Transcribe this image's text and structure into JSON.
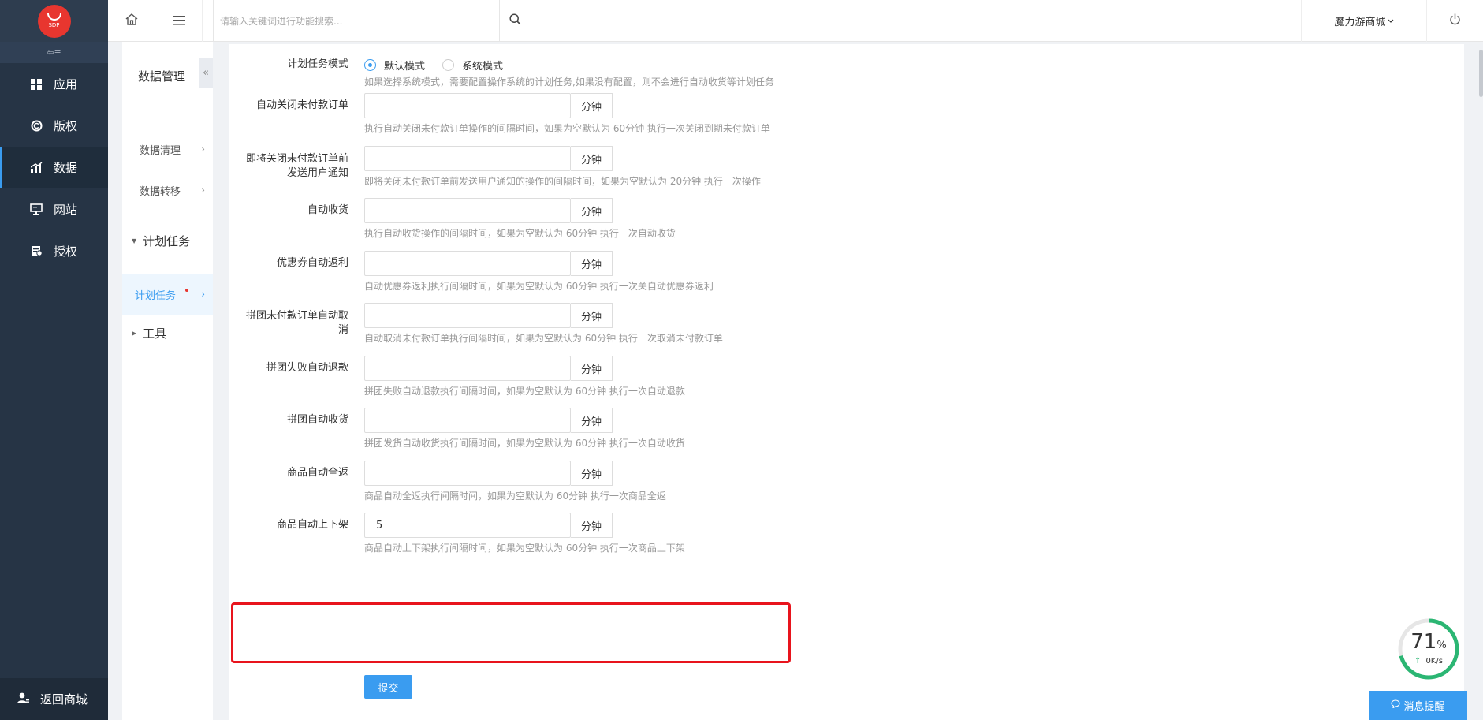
{
  "brand": {
    "logo_text": "SDP"
  },
  "sidebar": {
    "collapse_glyph": "⇦≡",
    "items": [
      {
        "label": "应用",
        "icon": "grid-icon"
      },
      {
        "label": "版权",
        "icon": "copyright-icon"
      },
      {
        "label": "数据",
        "icon": "bar-chart-icon",
        "active": true
      },
      {
        "label": "网站",
        "icon": "monitor-icon"
      },
      {
        "label": "授权",
        "icon": "certificate-icon"
      }
    ],
    "back_label": "返回商城"
  },
  "topbar": {
    "search_placeholder": "请输入关键词进行功能搜索...",
    "shop_name": "魔力游商城"
  },
  "subnav": {
    "title": "数据管理",
    "collapse_glyph": "«",
    "items": {
      "clean": "数据清理",
      "migrate": "数据转移",
      "group_tasks": "计划任务",
      "tasks": "计划任务",
      "group_tools": "工具"
    }
  },
  "form": {
    "mode": {
      "label": "计划任务模式",
      "option_default": "默认模式",
      "option_system": "系统模式",
      "selected": "默认模式",
      "help": "如果选择系统模式，需要配置操作系统的计划任务,如果没有配置，则不会进行自动收货等计划任务"
    },
    "unit": "分钟",
    "fields": [
      {
        "label": "自动关闭未付款订单",
        "value": "",
        "help": "执行自动关闭未付款订单操作的间隔时间，如果为空默认为 60分钟 执行一次关闭到期未付款订单"
      },
      {
        "label": "即将关闭未付款订单前发送用户通知",
        "value": "",
        "help": "即将关闭未付款订单前发送用户通知的操作的间隔时间，如果为空默认为 20分钟 执行一次操作"
      },
      {
        "label": "自动收货",
        "value": "",
        "help": "执行自动收货操作的间隔时间，如果为空默认为 60分钟 执行一次自动收货"
      },
      {
        "label": "优惠券自动返利",
        "value": "",
        "help": "自动优惠券返利执行间隔时间，如果为空默认为 60分钟 执行一次关自动优惠券返利"
      },
      {
        "label": "拼团未付款订单自动取消",
        "value": "",
        "help": "自动取消未付款订单执行间隔时间，如果为空默认为 60分钟 执行一次取消未付款订单"
      },
      {
        "label": "拼团失败自动退款",
        "value": "",
        "help": "拼团失败自动退款执行间隔时间，如果为空默认为 60分钟 执行一次自动退款"
      },
      {
        "label": "拼团自动收货",
        "value": "",
        "help": "拼团发货自动收货执行间隔时间，如果为空默认为 60分钟 执行一次自动收货"
      },
      {
        "label": "商品自动全返",
        "value": "",
        "help": "商品自动全返执行间隔时间，如果为空默认为 60分钟 执行一次商品全返"
      },
      {
        "label": "商品自动上下架",
        "value": "5",
        "help": "商品自动上下架执行间隔时间，如果为空默认为 60分钟 执行一次商品上下架"
      }
    ],
    "submit_label": "提交"
  },
  "widgets": {
    "gauge_value": "71",
    "gauge_unit": "%",
    "gauge_fraction": 0.71,
    "speed": "0K/s",
    "message_label": "消息提醒"
  },
  "colors": {
    "accent": "#3a9cf0",
    "sidebar": "#263445",
    "highlight": "#e8141d",
    "gauge": "#2bb673"
  }
}
